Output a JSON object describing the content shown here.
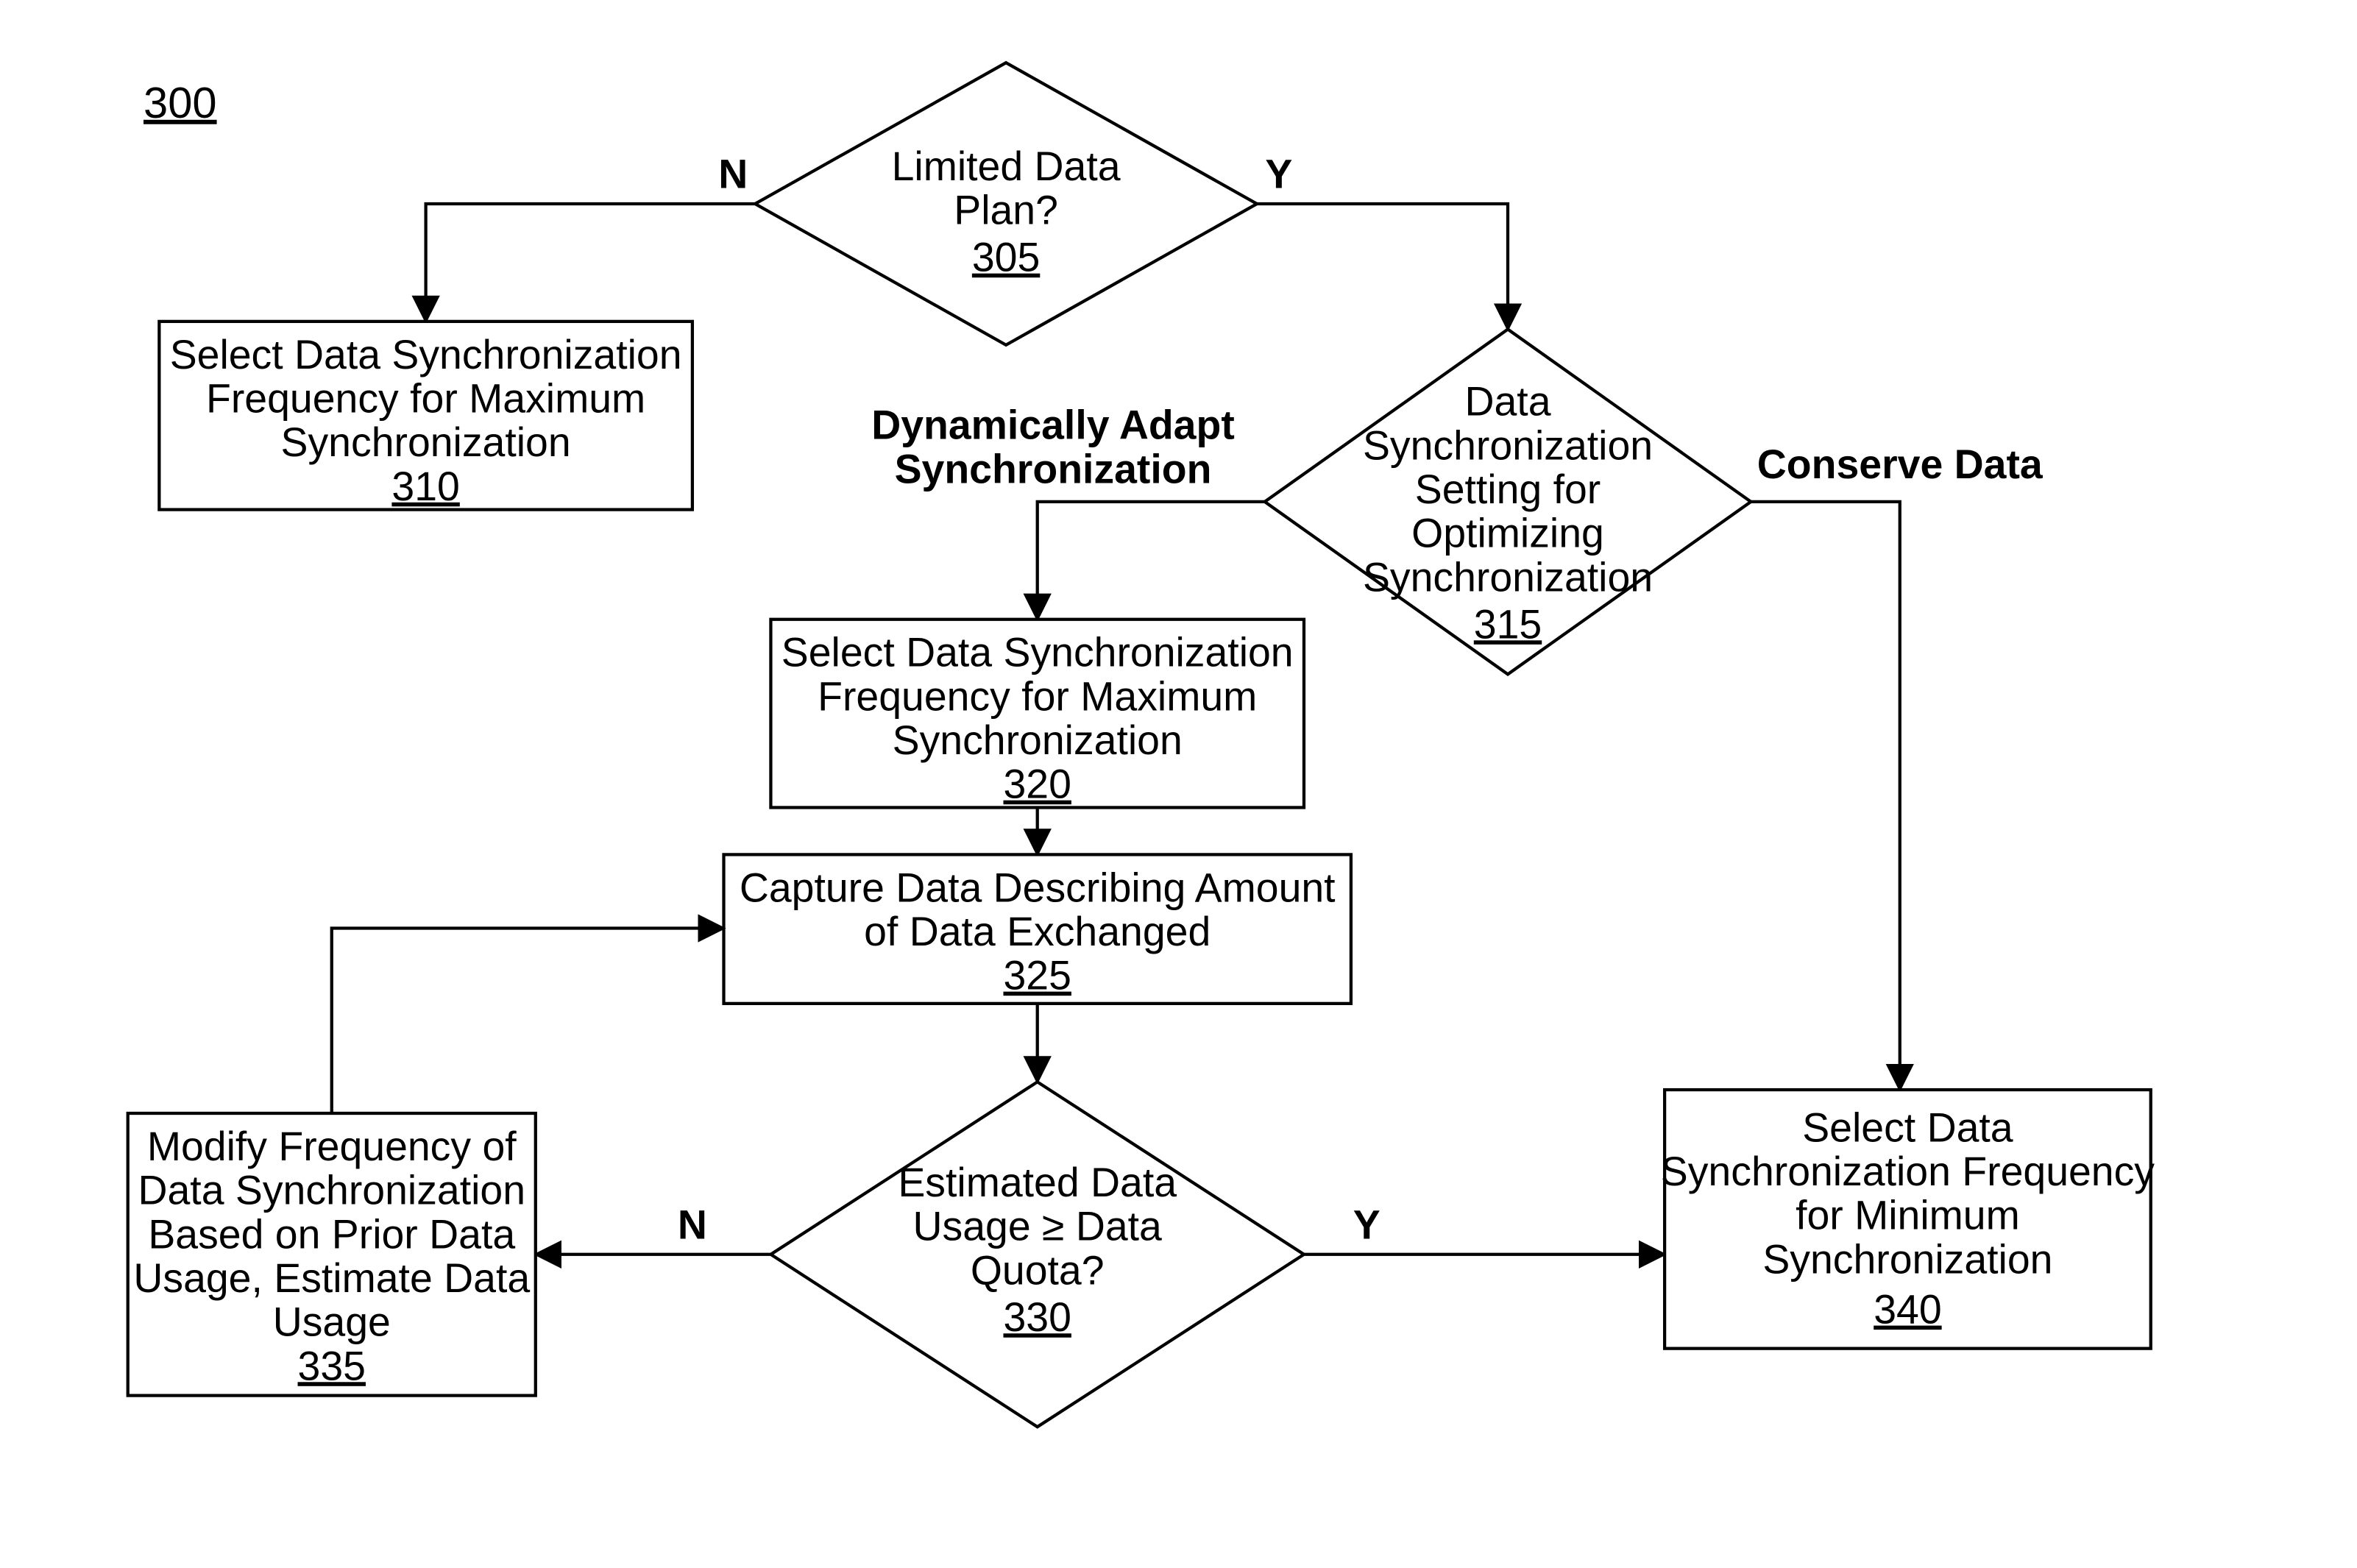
{
  "figure_ref": "300",
  "nodes": {
    "n305": {
      "line1": "Limited Data",
      "line2": "Plan?",
      "ref": "305"
    },
    "n310": {
      "line1": "Select Data Synchronization",
      "line2": "Frequency for Maximum",
      "line3": "Synchronization",
      "ref": "310"
    },
    "n315": {
      "line1": "Data",
      "line2": "Synchronization",
      "line3": "Setting for",
      "line4": "Optimizing",
      "line5": "Synchronization",
      "ref": "315"
    },
    "n320": {
      "line1": "Select Data Synchronization",
      "line2": "Frequency for Maximum",
      "line3": "Synchronization",
      "ref": "320"
    },
    "n325": {
      "line1": "Capture Data Describing Amount",
      "line2": "of Data Exchanged",
      "ref": "325"
    },
    "n330": {
      "line1": "Estimated Data",
      "line2": "Usage ≥ Data",
      "line3": "Quota?",
      "ref": "330"
    },
    "n335": {
      "line1": "Modify Frequency of",
      "line2": "Data Synchronization",
      "line3": "Based on Prior Data",
      "line4": "Usage, Estimate Data",
      "line5": "Usage",
      "ref": "335"
    },
    "n340": {
      "line1": "Select Data",
      "line2": "Synchronization Frequency",
      "line3": "for Minimum",
      "line4": "Synchronization",
      "ref": "340"
    }
  },
  "edges": {
    "e305_N": "N",
    "e305_Y": "Y",
    "e315_left_l1": "Dynamically Adapt",
    "e315_left_l2": "Synchronization",
    "e315_right": "Conserve Data",
    "e330_N": "N",
    "e330_Y": "Y"
  }
}
